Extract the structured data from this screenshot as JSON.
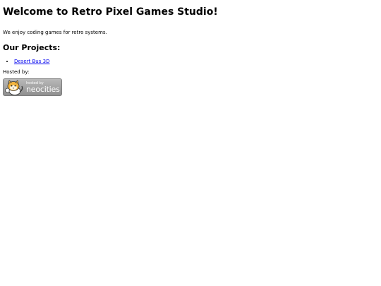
{
  "header": {
    "title": "Welcome to Retro Pixel Games Studio!"
  },
  "intro": {
    "text": "We enjoy coding games for retro systems."
  },
  "projects": {
    "heading": "Our Projects:",
    "items": [
      {
        "label": "Desert Bus 3D"
      }
    ]
  },
  "hosting": {
    "label": "Hosted by:",
    "badge_small": "hosted by",
    "badge_big": "neocities"
  },
  "colors": {
    "link": "#0000ee",
    "badge_bg": "#a6a6a6"
  }
}
